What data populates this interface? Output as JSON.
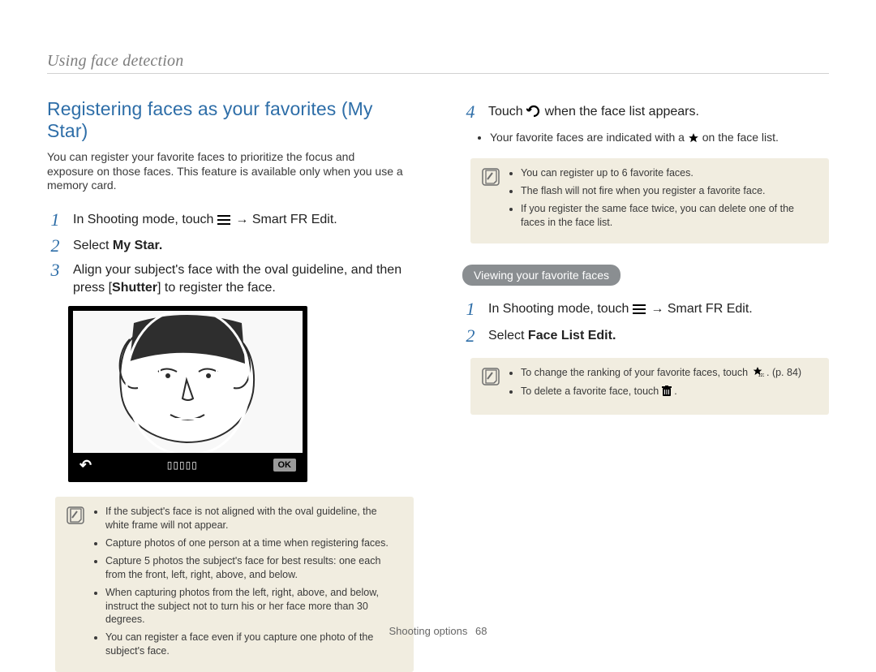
{
  "header": {
    "breadcrumb": "Using face detection"
  },
  "section": {
    "title": "Registering faces as your favorites (My Star)",
    "intro": "You can register your favorite faces to prioritize the focus and exposure on those faces. This feature is available only when you use a memory card."
  },
  "steps_left": [
    {
      "num": "1",
      "prefix": "In Shooting mode, touch ",
      "menu_icon": "m",
      "mid": "  → ",
      "suffix": "Smart FR Edit."
    },
    {
      "num": "2",
      "prefix": "Select ",
      "suffix": "My Star."
    },
    {
      "num": "3",
      "prefix": "Align your subject's face with the oval guideline, and then press [",
      "mid": "Shutter",
      "suffix": "] to register the face."
    }
  ],
  "illustration": {
    "back_icon": "↶",
    "dots": "▯▯▯▯▯",
    "ok": "OK"
  },
  "note_left": [
    "If the subject's face is not aligned with the oval guideline, the white frame will not appear.",
    "Capture photos of one person at a time when registering faces.",
    "Capture 5 photos the subject's face for best results: one each from the front, left, right, above, and below.",
    "When capturing photos from the left, right, above, and below, instruct the subject not to turn his or her face more than 30 degrees.",
    "You can register a face even if you capture one photo of the subject's face."
  ],
  "step4": {
    "num": "4",
    "prefix": "Touch ",
    "back_icon": "↶",
    "suffix": " when the face list appears.",
    "sub_prefix": "Your favorite faces are indicated with a ",
    "sub_suffix": " on the face list."
  },
  "note_right1": [
    "You can register up to 6 favorite faces.",
    "The flash will not fire when you register a favorite face.",
    "If you register the same face twice, you can delete one of the faces in the face list."
  ],
  "pill": "Viewing your favorite faces",
  "steps_right": [
    {
      "num": "1",
      "prefix": "In Shooting mode, touch ",
      "menu_icon": "m",
      "mid": "  → ",
      "suffix": "Smart FR Edit."
    },
    {
      "num": "2",
      "prefix": "Select ",
      "suffix": "Face List Edit."
    }
  ],
  "note_right2": {
    "item1_prefix": "To change the ranking of your favorite faces, touch ",
    "item1_suffix": ". (p. 84)",
    "item2_prefix": "To delete a favorite face, touch ",
    "item2_suffix": "."
  },
  "footer": {
    "section": "Shooting options",
    "page": "68"
  }
}
